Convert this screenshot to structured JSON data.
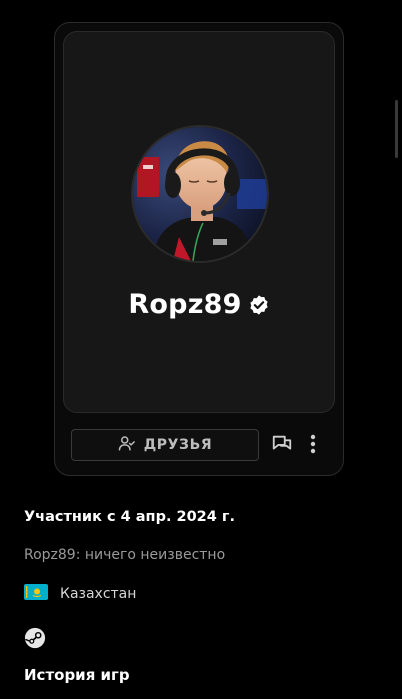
{
  "profile": {
    "username": "Ropz89",
    "verified": true,
    "avatar": "player-with-headset-photo"
  },
  "actions": {
    "friends_label": "ДРУЗЬЯ",
    "friends_icon": "user-check-icon",
    "messages_icon": "chat-bubbles-icon",
    "more_icon": "more-vertical-icon"
  },
  "info": {
    "member_since": "Участник с 4 апр. 2024 г.",
    "bio": "Ropz89: ничего неизвестно",
    "country": "Казахстан",
    "country_flag": "kazakhstan-flag",
    "steam_icon": "steam-icon"
  },
  "sections": {
    "games_history_title": "История игр"
  },
  "colors": {
    "background": "#000000",
    "card": "#171717",
    "border": "#2b2b2b",
    "muted_text": "#9a9a9a",
    "kz_flag_blue": "#00AFCA",
    "kz_flag_gold": "#FEC50C"
  }
}
